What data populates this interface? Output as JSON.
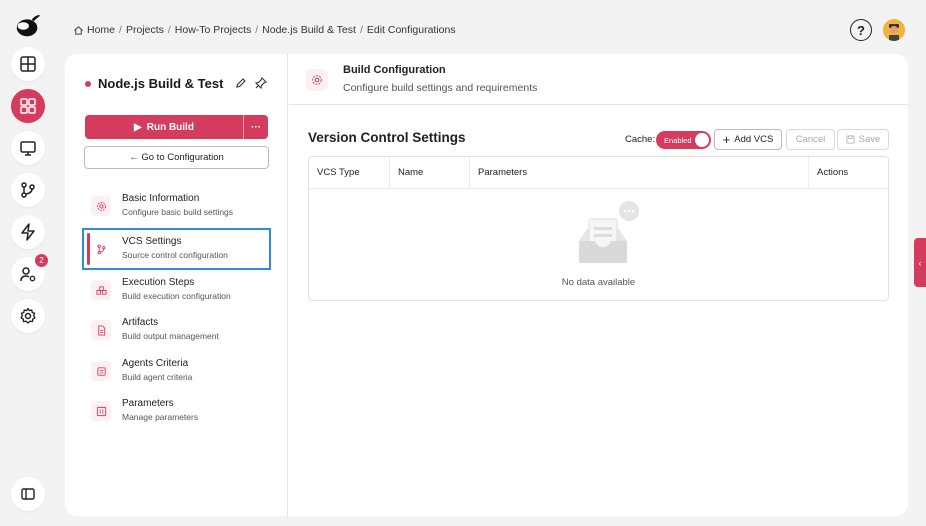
{
  "breadcrumb": [
    {
      "label": "Home"
    },
    {
      "label": "Projects"
    },
    {
      "label": "How-To Projects"
    },
    {
      "label": "Node.js Build & Test"
    },
    {
      "label": "Edit Configurations"
    }
  ],
  "rail": {
    "items": [
      {
        "icon": "dashboard-icon"
      },
      {
        "icon": "projects-icon",
        "active": true
      },
      {
        "icon": "monitor-icon"
      },
      {
        "icon": "git-branch-icon"
      },
      {
        "icon": "lightning-icon"
      },
      {
        "icon": "user-settings-icon",
        "badge": "2"
      },
      {
        "icon": "gear-icon"
      }
    ],
    "collapse_icon": "sidebar-toggle-icon"
  },
  "project": {
    "title": "Node.js Build & Test",
    "run_label": "Run Build",
    "more_label": "···",
    "goto_label": "← Go to Configuration"
  },
  "nav": [
    {
      "title": "Basic Information",
      "subtitle": "Configure basic build settings",
      "icon": "gear-icon"
    },
    {
      "title": "VCS Settings",
      "subtitle": "Source control configuration",
      "icon": "git-branch-icon",
      "selected": true
    },
    {
      "title": "Execution Steps",
      "subtitle": "Build execution configuration",
      "icon": "steps-icon"
    },
    {
      "title": "Artifacts",
      "subtitle": "Build output management",
      "icon": "file-icon"
    },
    {
      "title": "Agents Criteria",
      "subtitle": "Build agent criteria",
      "icon": "agent-icon"
    },
    {
      "title": "Parameters",
      "subtitle": "Manage parameters",
      "icon": "parameters-icon"
    }
  ],
  "header": {
    "title": "Build Configuration",
    "subtitle": "Configure build settings and requirements"
  },
  "vcs": {
    "title": "Version Control Settings",
    "cache_label": "Cache:",
    "cache_state": "Enabled",
    "add_label": "Add VCS",
    "cancel_label": "Cancel",
    "save_label": "Save",
    "columns": [
      "VCS Type",
      "Name",
      "Parameters",
      "Actions"
    ],
    "empty_message": "No data available"
  },
  "colors": {
    "accent": "#d43b5c",
    "highlight": "#2a8fd8"
  }
}
